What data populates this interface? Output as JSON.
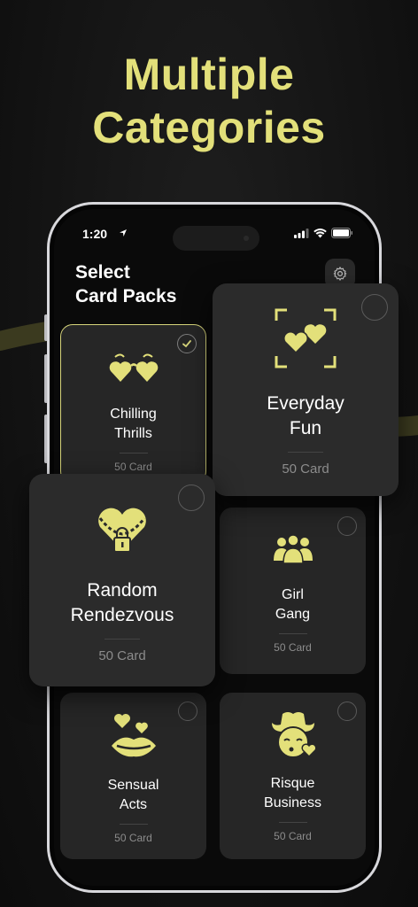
{
  "headline": {
    "line1": "Multiple",
    "line2": "Categories"
  },
  "status_bar": {
    "time": "1:20"
  },
  "screen": {
    "title_line1": "Select",
    "title_line2": "Card Packs"
  },
  "colors": {
    "accent": "#e3e07a",
    "card": "#262626",
    "background": "#0a0a0a"
  },
  "packs": [
    {
      "name_line1": "Chilling",
      "name_line2": "Thrills",
      "count": "50 Card",
      "icon": "heart-glasses-icon",
      "selected": true
    },
    {
      "name_line1": "Everyday",
      "name_line2": "Fun",
      "count": "50 Card",
      "icon": "hearts-frame-icon",
      "selected": false
    },
    {
      "name_line1": "Random",
      "name_line2": "Rendezvous",
      "count": "50 Card",
      "icon": "locked-heart-icon",
      "selected": false
    },
    {
      "name_line1": "Girl",
      "name_line2": "Gang",
      "count": "50 Card",
      "icon": "group-icon",
      "selected": false
    },
    {
      "name_line1": "Sensual",
      "name_line2": "Acts",
      "count": "50 Card",
      "icon": "kiss-lips-icon",
      "selected": false
    },
    {
      "name_line1": "Risque",
      "name_line2": "Business",
      "count": "50 Card",
      "icon": "cowboy-kiss-icon",
      "selected": false
    }
  ]
}
